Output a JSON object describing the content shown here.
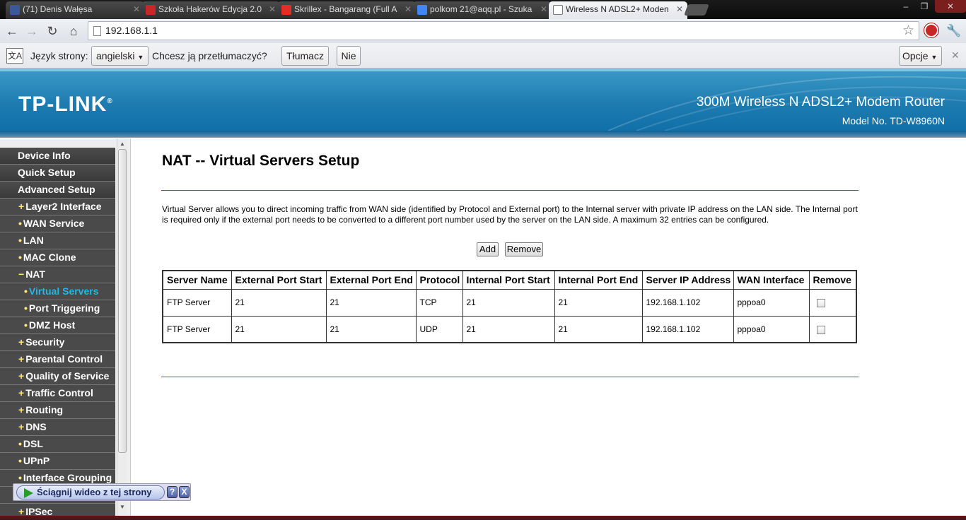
{
  "browser": {
    "tabs": [
      {
        "title": "(71) Denis Wałęsa",
        "favicon_color": "#3b5998",
        "active": false
      },
      {
        "title": "Szkoła Hakerów Edycja 2.0",
        "favicon_color": "#c62828",
        "active": false
      },
      {
        "title": "Skrillex - Bangarang (Full A",
        "favicon_color": "#e52d27",
        "active": false
      },
      {
        "title": "polkom 21@aqq.pl - Szuka",
        "favicon_color": "#4285f4",
        "active": false
      },
      {
        "title": "Wireless N ADSL2+ Moden",
        "favicon_color": "#ffffff",
        "active": true
      }
    ],
    "window_controls": {
      "minimize": "‒",
      "maximize": "❐",
      "close": "✕"
    },
    "url": "192.168.1.1",
    "nav_icons": [
      "back-icon",
      "forward-icon",
      "reload-icon",
      "home-icon",
      "star-icon",
      "extension-icon",
      "wrench-icon"
    ]
  },
  "translate_bar": {
    "label": "Język strony:",
    "language": "angielski",
    "question": "Chcesz ją przetłumaczyć?",
    "translate_btn": "Tłumacz",
    "no_btn": "Nie",
    "options_btn": "Opcje",
    "close": "✕"
  },
  "header": {
    "logo": "TP-LINK",
    "logo_mark": "®",
    "title": "300M Wireless N ADSL2+ Modem Router",
    "model": "Model No. TD-W8960N"
  },
  "sidebar": {
    "items": [
      {
        "label": "Device Info",
        "bullet": "",
        "level": 0
      },
      {
        "label": "Quick Setup",
        "bullet": "",
        "level": 0
      },
      {
        "label": "Advanced Setup",
        "bullet": "",
        "level": 0
      },
      {
        "label": "Layer2 Interface",
        "bullet": "+",
        "level": 1
      },
      {
        "label": "WAN Service",
        "bullet": "•",
        "level": 1
      },
      {
        "label": "LAN",
        "bullet": "•",
        "level": 1
      },
      {
        "label": "MAC Clone",
        "bullet": "•",
        "level": 1
      },
      {
        "label": "NAT",
        "bullet": "−",
        "level": 1
      },
      {
        "label": "Virtual Servers",
        "bullet": "•",
        "level": 2,
        "active": true
      },
      {
        "label": "Port Triggering",
        "bullet": "•",
        "level": 2
      },
      {
        "label": "DMZ Host",
        "bullet": "•",
        "level": 2
      },
      {
        "label": "Security",
        "bullet": "+",
        "level": 1
      },
      {
        "label": "Parental Control",
        "bullet": "+",
        "level": 1
      },
      {
        "label": "Quality of Service",
        "bullet": "+",
        "level": 1
      },
      {
        "label": "Traffic Control",
        "bullet": "+",
        "level": 1
      },
      {
        "label": "Routing",
        "bullet": "+",
        "level": 1
      },
      {
        "label": "DNS",
        "bullet": "+",
        "level": 1
      },
      {
        "label": "DSL",
        "bullet": "•",
        "level": 1
      },
      {
        "label": "UPnP",
        "bullet": "•",
        "level": 1
      },
      {
        "label": "Interface Grouping",
        "bullet": "•",
        "level": 1
      },
      {
        "label": "",
        "bullet": "",
        "level": 1
      },
      {
        "label": "IPSec",
        "bullet": "+",
        "level": 1
      }
    ]
  },
  "main": {
    "title": "NAT -- Virtual Servers Setup",
    "description": "Virtual Server allows you to direct incoming traffic from WAN side (identified by Protocol and External port) to the Internal server with private IP address on the LAN side. The Internal port is required only if the external port needs to be converted to a different port number used by the server on the LAN side. A maximum 32 entries can be configured.",
    "add_btn": "Add",
    "remove_btn": "Remove",
    "table": {
      "headers": [
        "Server Name",
        "External Port Start",
        "External Port End",
        "Protocol",
        "Internal Port Start",
        "Internal Port End",
        "Server IP Address",
        "WAN Interface",
        "Remove"
      ],
      "rows": [
        [
          "FTP Server",
          "21",
          "21",
          "TCP",
          "21",
          "21",
          "192.168.1.102",
          "pppoa0"
        ],
        [
          "FTP Server",
          "21",
          "21",
          "UDP",
          "21",
          "21",
          "192.168.1.102",
          "pppoa0"
        ]
      ]
    }
  },
  "download_bar": {
    "label": "Ściągnij wideo z tej strony",
    "help": "?",
    "close": "X"
  }
}
